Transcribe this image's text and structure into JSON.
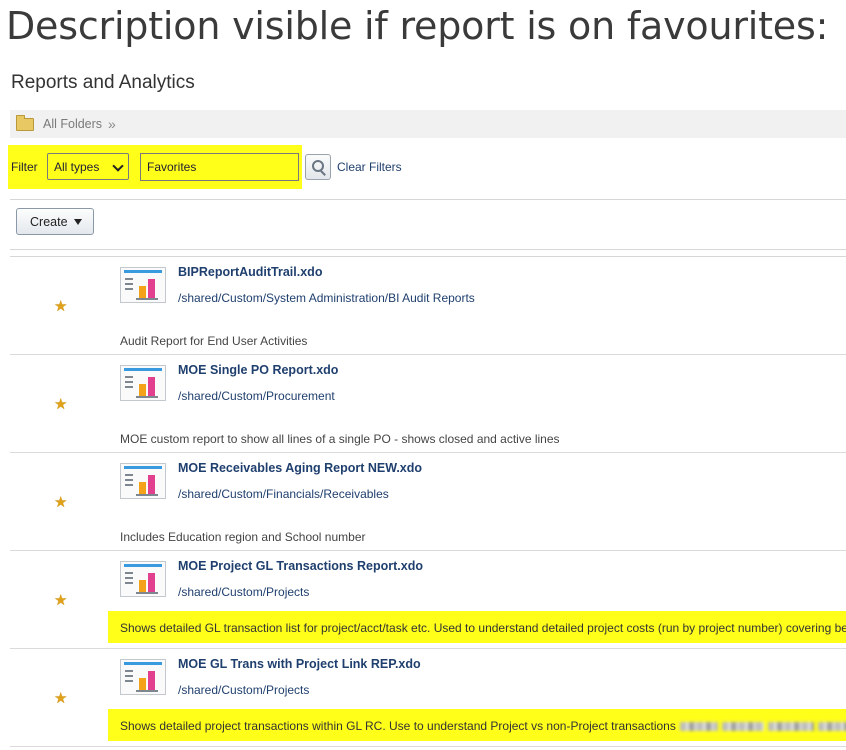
{
  "heading": "Description visible if report is on favourites:",
  "section_title": "Reports and Analytics",
  "breadcrumb": {
    "root": "All Folders",
    "separator": "»"
  },
  "filter": {
    "label": "Filter",
    "type_value": "All types",
    "text_value": "Favorites",
    "clear_label": "Clear Filters"
  },
  "toolbar": {
    "create_label": "Create"
  },
  "colors": {
    "highlight": "#ffff1a",
    "link": "#1f3f6e",
    "star": "#e0a21b",
    "icon_bar": "#3a9ae0"
  },
  "reports": [
    {
      "name": "BIPReportAuditTrail.xdo",
      "path": "/shared/Custom/System Administration/BI Audit Reports",
      "description": "Audit Report for End User Activities",
      "favorite": true,
      "highlighted": false
    },
    {
      "name": "MOE Single PO Report.xdo",
      "path": "/shared/Custom/Procurement",
      "description": "MOE custom report to show all lines of a single PO - shows closed and active lines",
      "favorite": true,
      "highlighted": false
    },
    {
      "name": "MOE Receivables Aging Report NEW.xdo",
      "path": "/shared/Custom/Financials/Receivables",
      "description": "Includes Education region and School number",
      "favorite": true,
      "highlighted": false
    },
    {
      "name": "MOE Project GL Transactions Report.xdo",
      "path": "/shared/Custom/Projects",
      "description": "Shows detailed GL transaction list for project/acct/task etc. Used to understand detailed project costs (run by project number) covering be",
      "favorite": true,
      "highlighted": true
    },
    {
      "name": "MOE GL Trans with Project Link REP.xdo",
      "path": "/shared/Custom/Projects",
      "description": "Shows detailed project transactions within GL RC. Use to understand Project vs non-Project transactions",
      "favorite": true,
      "highlighted": true
    }
  ]
}
